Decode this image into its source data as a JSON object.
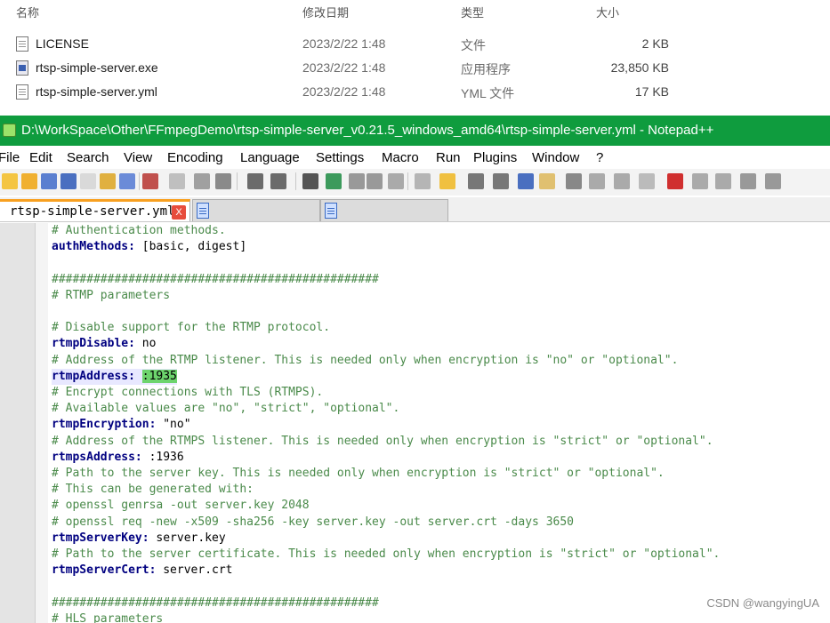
{
  "explorer": {
    "headers": {
      "name": "名称",
      "date": "修改日期",
      "type": "类型",
      "size": "大小"
    },
    "files": [
      {
        "name": "LICENSE",
        "date": "2023/2/22 1:48",
        "type": "文件",
        "size": "2 KB",
        "icon": "text-file-icon"
      },
      {
        "name": "rtsp-simple-server.exe",
        "date": "2023/2/22 1:48",
        "type": "应用程序",
        "size": "23,850 KB",
        "icon": "exe-file-icon"
      },
      {
        "name": "rtsp-simple-server.yml",
        "date": "2023/2/22 1:48",
        "type": "YML 文件",
        "size": "17 KB",
        "icon": "yml-file-icon"
      }
    ]
  },
  "notepad": {
    "title": "D:\\WorkSpace\\Other\\FFmpegDemo\\rtsp-simple-server_v0.21.5_windows_amd64\\rtsp-simple-server.yml - Notepad++",
    "title_color": "#0f9c3e",
    "menu": [
      "File",
      "Edit",
      "Search",
      "View",
      "Encoding",
      "Language",
      "Settings",
      "Macro",
      "Run",
      "Plugins",
      "Window",
      "?"
    ],
    "tabs": [
      {
        "label": "rtsp-simple-server.yml",
        "active": true,
        "close": "X"
      },
      {
        "label": "",
        "active": false
      },
      {
        "label": "",
        "active": false
      }
    ],
    "code": [
      {
        "text": "# Authentication methods.",
        "style": "comment"
      },
      {
        "key": "authMethods:",
        "value": " [basic, digest]",
        "style": "key"
      },
      {
        "text": "",
        "style": "blank"
      },
      {
        "text": "###############################################",
        "style": "comment"
      },
      {
        "text": "# RTMP parameters",
        "style": "comment"
      },
      {
        "text": "",
        "style": "blank"
      },
      {
        "text": "# Disable support for the RTMP protocol.",
        "style": "comment"
      },
      {
        "key": "rtmpDisable:",
        "value": " no",
        "style": "key"
      },
      {
        "text": "# Address of the RTMP listener. This is needed only when encryption is \"no\" or \"optional\".",
        "style": "comment"
      },
      {
        "key": "rtmpAddress:",
        "value": " :1935",
        "style": "key",
        "active": true,
        "highlight": ":1935"
      },
      {
        "text": "# Encrypt connections with TLS (RTMPS).",
        "style": "comment"
      },
      {
        "text": "# Available values are \"no\", \"strict\", \"optional\".",
        "style": "comment"
      },
      {
        "key": "rtmpEncryption:",
        "value": " \"no\"",
        "style": "key"
      },
      {
        "text": "# Address of the RTMPS listener. This is needed only when encryption is \"strict\" or \"optional\".",
        "style": "comment"
      },
      {
        "key": "rtmpsAddress:",
        "value": " :1936",
        "style": "key"
      },
      {
        "text": "# Path to the server key. This is needed only when encryption is \"strict\" or \"optional\".",
        "style": "comment"
      },
      {
        "text": "# This can be generated with:",
        "style": "comment"
      },
      {
        "text": "# openssl genrsa -out server.key 2048",
        "style": "comment"
      },
      {
        "text": "# openssl req -new -x509 -sha256 -key server.key -out server.crt -days 3650",
        "style": "comment"
      },
      {
        "key": "rtmpServerKey:",
        "value": " server.key",
        "style": "key"
      },
      {
        "text": "# Path to the server certificate. This is needed only when encryption is \"strict\" or \"optional\".",
        "style": "comment"
      },
      {
        "key": "rtmpServerCert:",
        "value": " server.crt",
        "style": "key"
      },
      {
        "text": "",
        "style": "blank"
      },
      {
        "text": "###############################################",
        "style": "comment"
      },
      {
        "text": "# HLS parameters",
        "style": "comment"
      }
    ],
    "watermark": "CSDN @wangyingUA"
  }
}
